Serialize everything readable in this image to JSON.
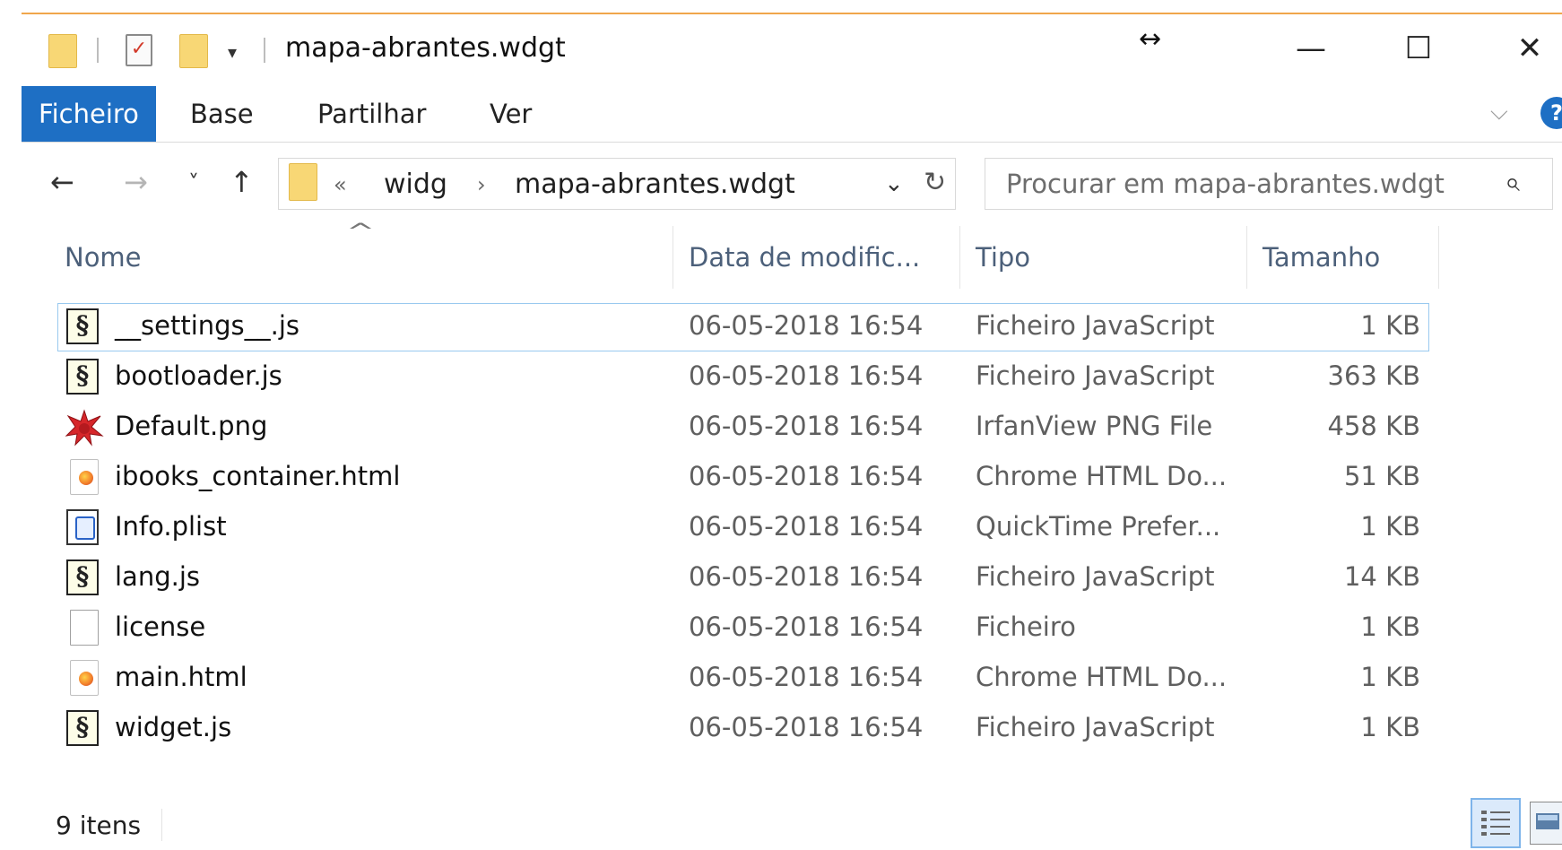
{
  "window": {
    "title": "mapa-abrantes.wdgt",
    "accent_color": "#1e6fc4",
    "quick_access": {
      "dropdown_icon": "▾"
    },
    "controls": {
      "resize": "↔",
      "minimize": "—",
      "maximize": "☐",
      "close": "✕"
    }
  },
  "ribbon": {
    "tabs": [
      "Ficheiro",
      "Base",
      "Partilhar",
      "Ver"
    ],
    "active_tab": "Ficheiro",
    "expand_icon": "⌵",
    "help_label": "?"
  },
  "nav": {
    "back": "←",
    "forward": "→",
    "recent": "˅",
    "up": "↑",
    "overflow": "«",
    "breadcrumb": [
      "widg",
      "mapa-abrantes.wdgt"
    ],
    "separator": "›",
    "dropdown": "⌄",
    "refresh": "↻"
  },
  "search": {
    "placeholder": "Procurar em mapa-abrantes.wdgt",
    "icon": "⌕"
  },
  "columns": {
    "sort_indicator": "^",
    "name": "Nome",
    "date": "Data de modific...",
    "type": "Tipo",
    "size": "Tamanho"
  },
  "files": [
    {
      "name": "__settings__.js",
      "date": "06-05-2018 16:54",
      "type": "Ficheiro JavaScript",
      "size": "1 KB",
      "icon": "js-script-icon",
      "selected": true
    },
    {
      "name": "bootloader.js",
      "date": "06-05-2018 16:54",
      "type": "Ficheiro JavaScript",
      "size": "363 KB",
      "icon": "js-script-icon"
    },
    {
      "name": "Default.png",
      "date": "06-05-2018 16:54",
      "type": "IrfanView PNG File",
      "size": "458 KB",
      "icon": "irfanview-png-icon"
    },
    {
      "name": "ibooks_container.html",
      "date": "06-05-2018 16:54",
      "type": "Chrome HTML Do...",
      "size": "51 KB",
      "icon": "html-file-icon"
    },
    {
      "name": "Info.plist",
      "date": "06-05-2018 16:54",
      "type": "QuickTime Prefer...",
      "size": "1 KB",
      "icon": "plist-file-icon"
    },
    {
      "name": "lang.js",
      "date": "06-05-2018 16:54",
      "type": "Ficheiro JavaScript",
      "size": "14 KB",
      "icon": "js-script-icon"
    },
    {
      "name": "license",
      "date": "06-05-2018 16:54",
      "type": "Ficheiro",
      "size": "1 KB",
      "icon": "blank-file-icon"
    },
    {
      "name": "main.html",
      "date": "06-05-2018 16:54",
      "type": "Chrome HTML Do...",
      "size": "1 KB",
      "icon": "html-file-icon"
    },
    {
      "name": "widget.js",
      "date": "06-05-2018 16:54",
      "type": "Ficheiro JavaScript",
      "size": "1 KB",
      "icon": "js-script-icon"
    }
  ],
  "status": {
    "item_count": "9 itens"
  },
  "glyphs": {
    "js": "§"
  }
}
